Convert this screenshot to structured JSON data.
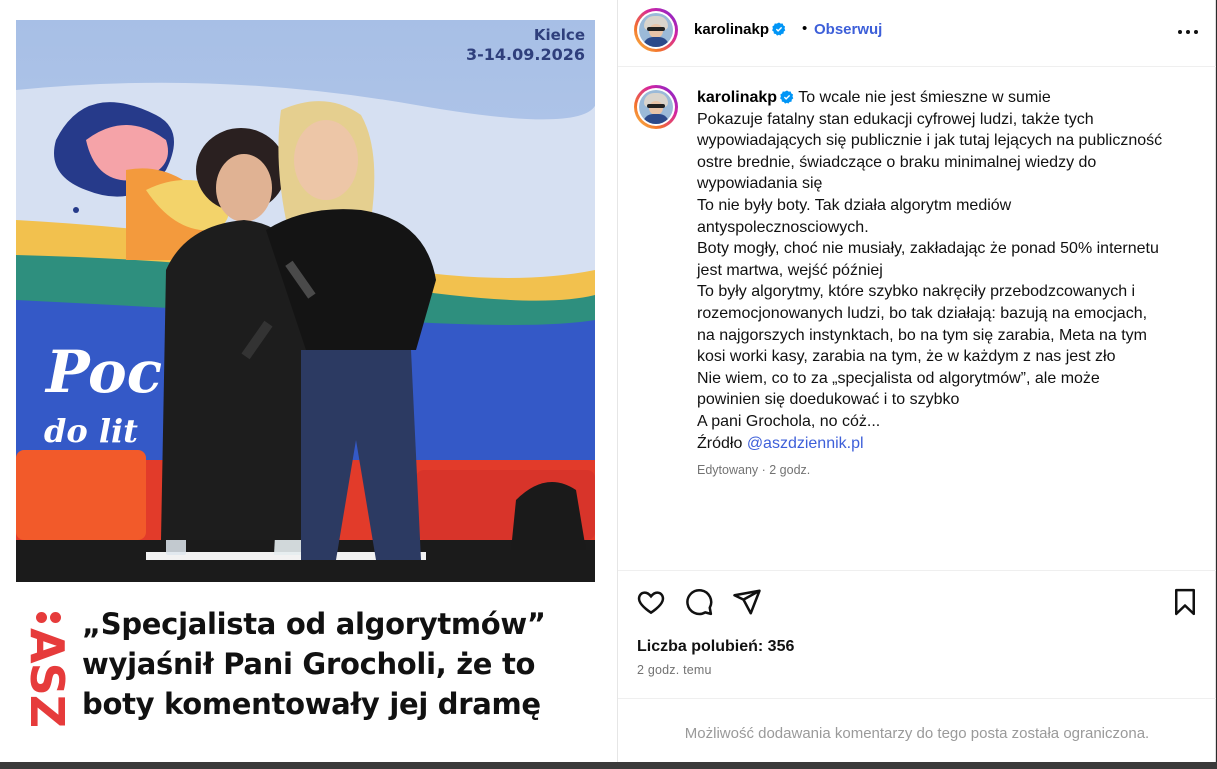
{
  "media": {
    "banner_city": "Kielce",
    "banner_dates": "3-14.09.2026",
    "banner_word_1": "Poc",
    "banner_word_2": "do lit",
    "logo_text": "ASZ",
    "headline_lines": [
      "„Specjalista od algorytmów”",
      "wyjaśnił Pani Grocholi, że to",
      "boty komentowały jej dramę"
    ]
  },
  "header": {
    "username": "karolinakp",
    "separator": "•",
    "follow_label": "Obserwuj"
  },
  "post": {
    "username": "karolinakp",
    "first_line": "To wcale nie jest śmieszne w sumie",
    "lines": [
      "Pokazuje fatalny stan edukacji cyfrowej ludzi, także tych",
      "wypowiadających się publicznie i jak tutaj lejących na publiczność",
      "ostre brednie, świadczące o braku minimalnej wiedzy do",
      "wypowiadania się",
      "To nie były boty. Tak działa algorytm mediów",
      "antyspolecznosciowych.",
      "Boty mogły, choć nie musiały, zakładając że ponad 50% internetu",
      "jest martwa, wejść później",
      "To były algorytmy, które szybko nakręciły przebodzcowanych i",
      "rozemocjonowanych ludzi, bo tak działają: bazują na emocjach,",
      "na najgorszych instynktach, bo na tym się zarabia, Meta na tym",
      "kosi worki kasy, zarabia na tym, że w każdym z nas jest zło",
      "Nie wiem, co to za „specjalista od algorytmów”, ale może",
      "powinien się doedukować i to szybko",
      "A pani Grochola, no cóż..."
    ],
    "source_label": "Źródło",
    "source_mention": "@aszdziennik.pl",
    "meta": "Edytowany · 2 godz."
  },
  "actions": {
    "icons": [
      "heart-icon",
      "comment-icon",
      "share-icon",
      "bookmark-icon"
    ],
    "likes_text": "Liczba polubień: 356",
    "time_ago": "2 godz. temu"
  },
  "footer": {
    "comments_note": "Możliwość dodawania komentarzy do tego posta została ograniczona."
  },
  "colors": {
    "link": "#3d5fd9",
    "verified": "#0095f6",
    "logo_red": "#e63b3b",
    "muted": "#737373"
  }
}
